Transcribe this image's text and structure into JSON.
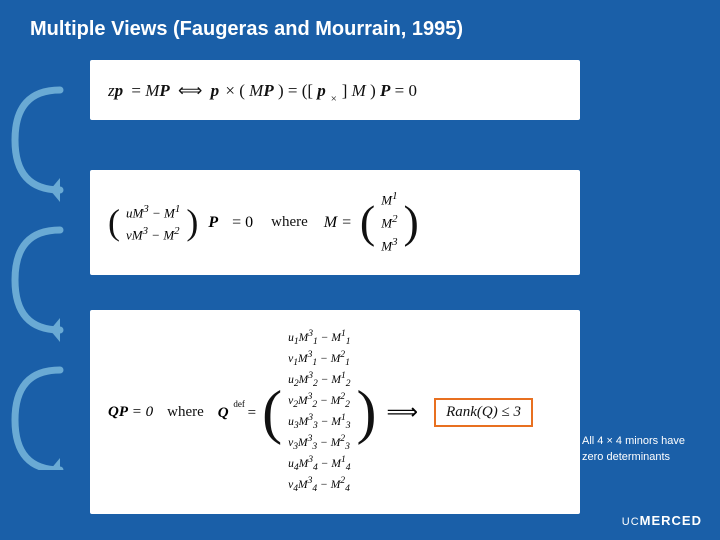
{
  "page": {
    "title": "Multiple Views (Faugeras and Mourrain, 1995)",
    "background_color": "#1a5fa8",
    "accent_color": "#e87020"
  },
  "equations": {
    "top": {
      "content": "zp = MP ⟺ p × (MP) = ([p×]M)P = 0"
    },
    "middle": {
      "matrix_rows": [
        "uM³ − M¹",
        "vM³ − M²"
      ],
      "bold_P": "P",
      "equals_zero": "= 0",
      "where_label": "where",
      "M_label": "M",
      "M_rows": [
        "M¹",
        "M²",
        "M³"
      ]
    },
    "bottom": {
      "QP_label": "QP = 0",
      "where_label": "where",
      "Q_def_label": "Q",
      "def_label": "def",
      "Q_rows": [
        "u₁M³₁ − M¹₁",
        "v₁M³₁ − M²₁",
        "u₂M³₂ − M¹₂",
        "v₂M³₂ − M²₂",
        "u₃M³₃ − M¹₃",
        "v₃M³₃ − M²₃",
        "u₄M³₄ − M¹₄",
        "v₄M³₄ − M²₄"
      ],
      "rank_label": "Rank(Q) ≤ 3"
    }
  },
  "annotation": {
    "text": "All 4 × 4 minors have zero determinants"
  },
  "footer": {
    "logo": "UC MERCED"
  }
}
